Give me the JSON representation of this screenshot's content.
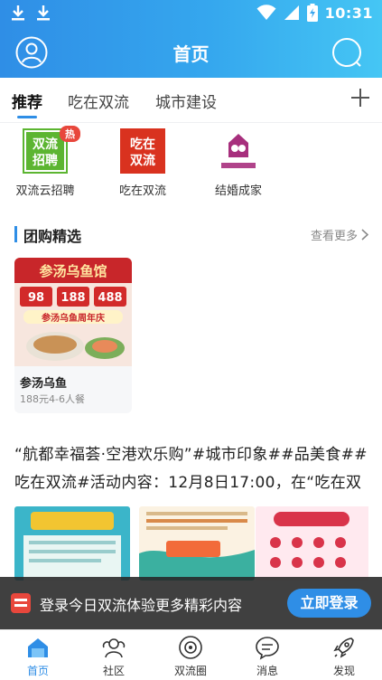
{
  "status_bar": {
    "time": "10:31",
    "left_icons": [
      "download-icon",
      "download-icon"
    ],
    "right_icons": [
      "wifi-icon",
      "signal-icon",
      "battery-charging-icon"
    ]
  },
  "header": {
    "title": "首页",
    "left_icon": "avatar-icon",
    "right_icon": "search-icon",
    "gradient": [
      "#2f8ee6",
      "#45c6f4"
    ]
  },
  "tabs": [
    {
      "label": "推荐",
      "active": true
    },
    {
      "label": "吃在双流",
      "active": false
    },
    {
      "label": "城市建设",
      "active": false
    }
  ],
  "tab_add_icon": "plus-icon",
  "shortcuts": [
    {
      "label": "双流云招聘",
      "icon_text": "双流\n招聘",
      "badge": "热"
    },
    {
      "label": "吃在双流",
      "icon_text": "吃在\n双流"
    },
    {
      "label": "结婚成家",
      "icon_text": "结婚成家"
    }
  ],
  "group_buy": {
    "title": "团购精选",
    "more": "查看更多",
    "items": [
      {
        "name": "参汤乌鱼",
        "price": "188元4-6人餐",
        "poster_title": "参汤乌鱼馆",
        "poster_prices": [
          "98",
          "188",
          "488"
        ],
        "poster_banner": "参汤乌鱼周年庆"
      }
    ]
  },
  "post": {
    "text": "“航都幸福荟·空港欢乐购”#城市印象##品美食##吃在双流#活动内容：12月8日17:00，在“吃在双"
  },
  "login_bar": {
    "text": "登录今日双流体验更多精彩内容",
    "button": "立即登录"
  },
  "bottom_nav": [
    {
      "label": "首页",
      "icon": "home-icon",
      "active": true
    },
    {
      "label": "社区",
      "icon": "community-icon",
      "active": false
    },
    {
      "label": "双流圈",
      "icon": "circle-icon",
      "active": false
    },
    {
      "label": "消息",
      "icon": "message-icon",
      "active": false
    },
    {
      "label": "发现",
      "icon": "rocket-icon",
      "active": false
    }
  ],
  "colors": {
    "accent": "#2f8ee6",
    "hot_badge": "#e8473c",
    "login_overlay": "#262626"
  }
}
